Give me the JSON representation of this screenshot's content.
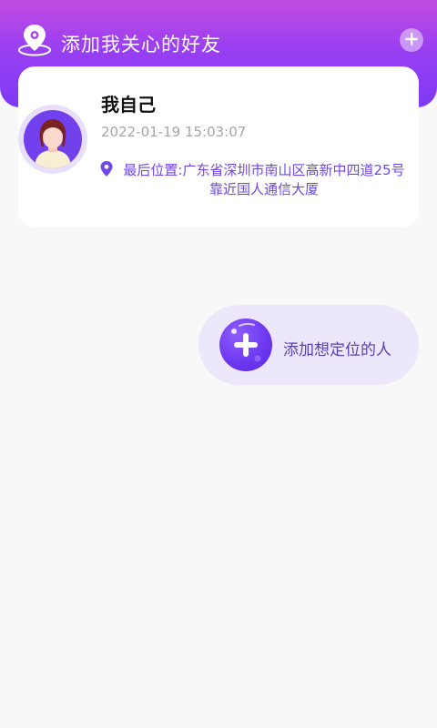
{
  "header": {
    "title": "添加我关心的好友",
    "location_icon": "location-pin-icon",
    "add_icon": "plus-icon"
  },
  "card": {
    "name": "我自己",
    "timestamp": "2022-01-19 15:03:07",
    "location_label": "最后位置:广东省深圳市南山区高新中四道25号靠近国人通信大厦",
    "location_icon": "map-pin-icon",
    "avatar_icon": "user-avatar"
  },
  "add_person": {
    "label": "添加想定位的人",
    "icon": "plus-circle-icon"
  },
  "colors": {
    "header_gradient_start": "#c24be0",
    "header_gradient_end": "#7c3af5",
    "accent": "#7046e8",
    "pill_background": "#ede7fb"
  }
}
